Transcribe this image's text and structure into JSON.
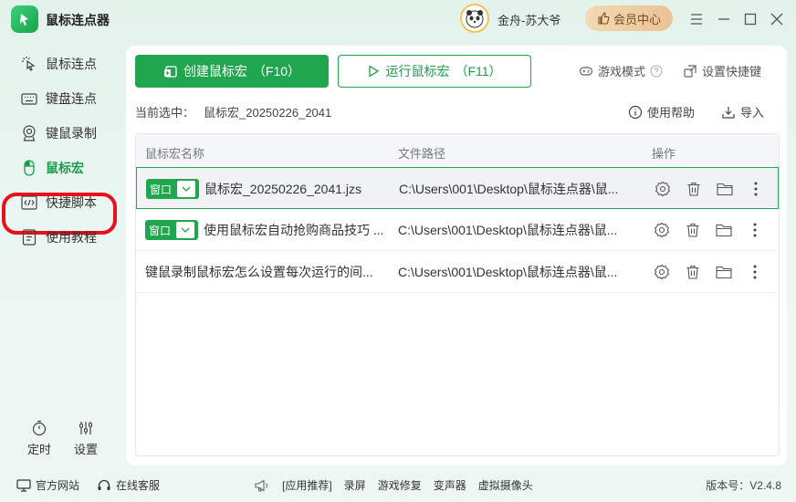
{
  "app": {
    "title": "鼠标连点器"
  },
  "user": {
    "name": "金舟-苏大爷",
    "vip_label": "会员中心"
  },
  "colors": {
    "accent": "#1fa64f",
    "highlight_ring": "#e8101a",
    "vip_bg": "#f3d9b5"
  },
  "sidebar": {
    "items": [
      {
        "label": "鼠标连点",
        "icon": "mouse-click-icon"
      },
      {
        "label": "键盘连点",
        "icon": "keyboard-icon"
      },
      {
        "label": "键鼠录制",
        "icon": "record-icon"
      },
      {
        "label": "鼠标宏",
        "icon": "mouse-icon",
        "active": true
      },
      {
        "label": "快捷脚本",
        "icon": "script-icon"
      },
      {
        "label": "使用教程",
        "icon": "tutorial-icon"
      }
    ],
    "bottom": [
      {
        "label": "定时",
        "icon": "timer-icon"
      },
      {
        "label": "设置",
        "icon": "settings-sliders-icon"
      }
    ]
  },
  "toolbar": {
    "create_label": "创建鼠标宏",
    "create_hotkey": "（F10）",
    "run_label": "运行鼠标宏",
    "run_hotkey": "（F11）",
    "game_mode_label": "游戏模式",
    "shortcut_label": "设置快捷键"
  },
  "selection": {
    "prefix": "当前选中：",
    "value": "鼠标宏_20250226_2041"
  },
  "links": {
    "help_label": "使用帮助",
    "import_label": "导入"
  },
  "table": {
    "columns": [
      "鼠标宏名称",
      "文件路径",
      "操作"
    ],
    "rows": [
      {
        "badge": "窗口",
        "name": "鼠标宏_20250226_2041.jzs",
        "path": "C:\\Users\\001\\Desktop\\鼠标连点器\\鼠...",
        "selected": true
      },
      {
        "badge": "窗口",
        "name": "使用鼠标宏自动抢购商品技巧 ...",
        "path": "C:\\Users\\001\\Desktop\\鼠标连点器\\鼠...",
        "selected": false
      },
      {
        "badge": "",
        "name": "键鼠录制鼠标宏怎么设置每次运行的间...",
        "path": "C:\\Users\\001\\Desktop\\鼠标连点器\\鼠...",
        "selected": false
      }
    ]
  },
  "footer": {
    "website_label": "官方网站",
    "service_label": "在线客服",
    "promo": [
      "[应用推荐]",
      "录屏",
      "游戏修复",
      "变声器",
      "虚拟摄像头"
    ],
    "version": "版本号：V2.4.8"
  }
}
